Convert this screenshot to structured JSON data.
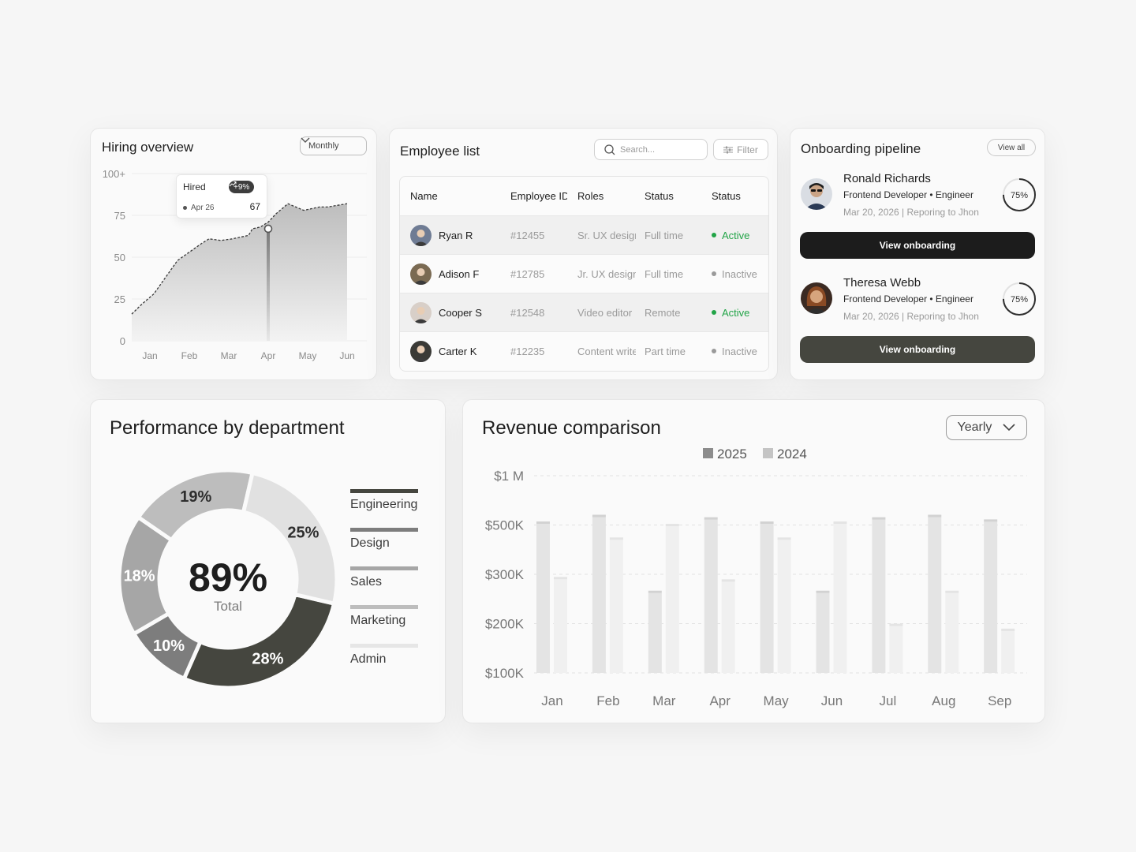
{
  "hiring": {
    "title": "Hiring overview",
    "period": "Monthly",
    "tooltip": {
      "label": "Hired",
      "change": "+9%",
      "date": "Apr 26",
      "value": "67"
    },
    "chart_data": {
      "type": "area",
      "title": "Hiring overview",
      "x": [
        "Jan",
        "Feb",
        "Mar",
        "Apr",
        "May",
        "Jun"
      ],
      "y_ticks": [
        "100+",
        "75",
        "50",
        "25",
        "0"
      ],
      "ylim": [
        0,
        100
      ],
      "points": [
        [
          0,
          16
        ],
        [
          0.3,
          22
        ],
        [
          0.6,
          28
        ],
        [
          0.9,
          38
        ],
        [
          1.2,
          48
        ],
        [
          1.5,
          53
        ],
        [
          1.8,
          58
        ],
        [
          2.0,
          61
        ],
        [
          2.3,
          60
        ],
        [
          2.6,
          61
        ],
        [
          3.0,
          63
        ],
        [
          3.1,
          67
        ],
        [
          3.3,
          68
        ],
        [
          3.5,
          71
        ],
        [
          3.7,
          76
        ],
        [
          4.0,
          82
        ],
        [
          4.2,
          80
        ],
        [
          4.4,
          78
        ],
        [
          4.6,
          79
        ],
        [
          4.8,
          80
        ],
        [
          5.0,
          80
        ],
        [
          5.5,
          82
        ]
      ],
      "highlight": {
        "x": "Apr",
        "value": 67
      }
    }
  },
  "employees": {
    "title": "Employee list",
    "search_placeholder": "Search...",
    "filter_label": "Filter",
    "headers": [
      "Name",
      "Employee ID",
      "Roles",
      "Status",
      "Status"
    ],
    "rows": [
      {
        "name": "Ryan R",
        "id": "#12455",
        "role": "Sr. UX designer",
        "type": "Full time",
        "status": "Active",
        "status_color": "#22a447",
        "avatar_bg": "#6f7c94"
      },
      {
        "name": "Adison F",
        "id": "#12785",
        "role": "Jr. UX designer",
        "type": "Full time",
        "status": "Inactive",
        "status_color": "#9a9a9a",
        "avatar_bg": "#7a6a52"
      },
      {
        "name": "Cooper S",
        "id": "#12548",
        "role": "Video editor",
        "type": "Remote",
        "status": "Active",
        "status_color": "#22a447",
        "avatar_bg": "#d8cfc8"
      },
      {
        "name": "Carter K",
        "id": "#12235",
        "role": "Content writer",
        "type": "Part time",
        "status": "Inactive",
        "status_color": "#9a9a9a",
        "avatar_bg": "#3a3a36"
      }
    ]
  },
  "onboarding": {
    "title": "Onboarding pipeline",
    "view_all": "View all",
    "people": [
      {
        "name": "Ronald Richards",
        "role": "Frontend Developer • Engineer",
        "meta": "Mar 20, 2026 | Reporing to Jhon",
        "progress": 75,
        "progress_label": "75%",
        "button": "View onboarding",
        "button_color": "#1c1c1c"
      },
      {
        "name": "Theresa Webb",
        "role": "Frontend Developer • Engineer",
        "meta": "Mar 20, 2026 | Reporing to Jhon",
        "progress": 75,
        "progress_label": "75%",
        "button": "View onboarding",
        "button_color": "#45463f"
      }
    ]
  },
  "performance": {
    "title": "Performance by department",
    "total_value": "89%",
    "total_label": "Total",
    "chart_data": {
      "type": "pie",
      "slices": [
        {
          "name": "Engineering",
          "value": 28,
          "label": "28%",
          "color": "#45463f",
          "text_color": "#ffffff"
        },
        {
          "name": "Design",
          "value": 10,
          "label": "10%",
          "color": "#7d7d7d",
          "text_color": "#ffffff"
        },
        {
          "name": "Sales",
          "value": 18,
          "label": "18%",
          "color": "#a6a6a6",
          "text_color": "#ffffff"
        },
        {
          "name": "Marketing",
          "value": 19,
          "label": "19%",
          "color": "#bdbdbd",
          "text_color": "#2e2e2e"
        },
        {
          "name": "Admin",
          "value": 25,
          "label": "25%",
          "color": "#e1e1e1",
          "text_color": "#2e2e2e"
        }
      ]
    },
    "legend": [
      {
        "label": "Engineering",
        "color": "#45463f"
      },
      {
        "label": "Design",
        "color": "#7d7d7d"
      },
      {
        "label": "Sales",
        "color": "#a6a6a6"
      },
      {
        "label": "Marketing",
        "color": "#bdbdbd"
      },
      {
        "label": "Admin",
        "color": "#e6e6e6"
      }
    ]
  },
  "revenue": {
    "title": "Revenue comparison",
    "period": "Yearly",
    "chart_data": {
      "type": "bar",
      "categories": [
        "Jan",
        "Feb",
        "Mar",
        "Apr",
        "May",
        "Jun",
        "Jul",
        "Aug",
        "Sep"
      ],
      "y_ticks": [
        "$1 M",
        "$500K",
        "$300K",
        "$200K",
        "$100K"
      ],
      "series": [
        {
          "name": "2025",
          "color": "#e4e4e4",
          "legend_color": "#8c8c8c",
          "values": [
            512,
            580,
            262,
            555,
            512,
            262,
            555,
            580,
            533
          ]
        },
        {
          "name": "2024",
          "color": "#f0f0f0",
          "legend_color": "#c4c4c4",
          "values": [
            290,
            440,
            495,
            285,
            440,
            512,
            195,
            262,
            185
          ]
        }
      ]
    }
  }
}
